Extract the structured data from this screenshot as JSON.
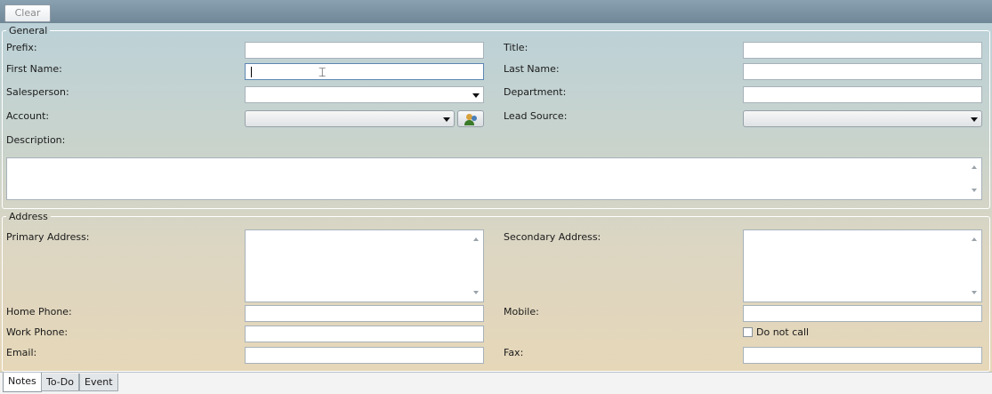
{
  "toolbar": {
    "clear_label": "Clear"
  },
  "general": {
    "legend": "General",
    "prefix_label": "Prefix:",
    "title_label": "Title:",
    "first_name_label": "First Name:",
    "last_name_label": "Last Name:",
    "salesperson_label": "Salesperson:",
    "department_label": "Department:",
    "account_label": "Account:",
    "lead_source_label": "Lead Source:",
    "description_label": "Description:"
  },
  "address": {
    "legend": "Address",
    "primary_address_label": "Primary Address:",
    "secondary_address_label": "Secondary Address:",
    "home_phone_label": "Home Phone:",
    "mobile_label": "Mobile:",
    "work_phone_label": "Work Phone:",
    "do_not_call_label": "Do not call",
    "email_label": "Email:",
    "fax_label": "Fax:"
  },
  "tabs": [
    {
      "label": "Notes",
      "selected": true
    },
    {
      "label": "To-Do",
      "selected": false
    },
    {
      "label": "Event",
      "selected": false
    }
  ],
  "colors": {
    "toolbar": "#7a92a3",
    "focus_border": "#5d87b4"
  }
}
